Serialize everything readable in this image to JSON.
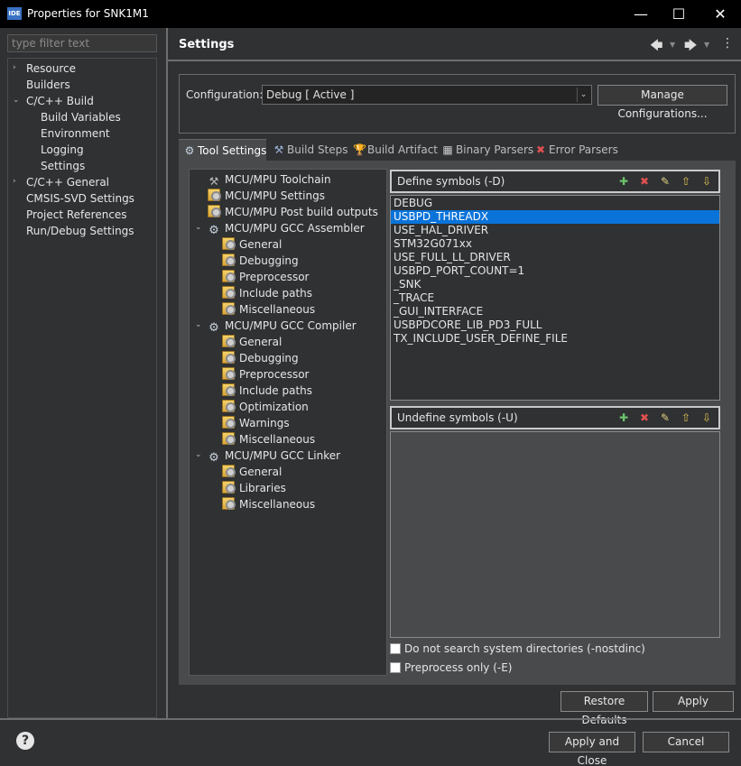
{
  "window": {
    "app_icon": "IDE",
    "title": "Properties for SNK1M1",
    "minimize": "—",
    "maximize": "☐",
    "close": "✕"
  },
  "filter": {
    "placeholder": "type filter text"
  },
  "nav": {
    "items": [
      {
        "label": "Resource",
        "expand": "›"
      },
      {
        "label": "Builders",
        "expand": ""
      },
      {
        "label": "C/C++ Build",
        "expand": "⌄"
      },
      {
        "label": "Build Variables",
        "expand": ""
      },
      {
        "label": "Environment",
        "expand": ""
      },
      {
        "label": "Logging",
        "expand": ""
      },
      {
        "label": "Settings",
        "expand": ""
      },
      {
        "label": "C/C++ General",
        "expand": "›"
      },
      {
        "label": "CMSIS-SVD Settings",
        "expand": ""
      },
      {
        "label": "Project References",
        "expand": ""
      },
      {
        "label": "Run/Debug Settings",
        "expand": ""
      }
    ]
  },
  "page": {
    "title": "Settings",
    "back_icon": "🡄",
    "forward_icon": "🡆",
    "menu_icon": "⋮"
  },
  "config": {
    "label": "Configuration:",
    "value": "Debug  [ Active ]",
    "manage_label": "Manage Configurations..."
  },
  "tabs": [
    {
      "label": "Tool Settings",
      "icon": "gear-icon",
      "active": true
    },
    {
      "label": "Build Steps",
      "icon": "hammer-icon",
      "active": false
    },
    {
      "label": "Build Artifact",
      "icon": "trophy-icon",
      "active": false
    },
    {
      "label": "Binary Parsers",
      "icon": "binary-icon",
      "active": false
    },
    {
      "label": "Error Parsers",
      "icon": "error-icon",
      "active": false
    }
  ],
  "tool_tree": [
    {
      "label": "MCU/MPU Toolchain",
      "icon": "toolchain-icon"
    },
    {
      "label": "MCU/MPU Settings",
      "icon": "folder-icon"
    },
    {
      "label": "MCU/MPU Post build outputs",
      "icon": "folder-icon"
    },
    {
      "label": "MCU/MPU GCC Assembler",
      "icon": "gear-icon",
      "expand": "⌄"
    },
    {
      "label": "General",
      "icon": "folder-icon"
    },
    {
      "label": "Debugging",
      "icon": "folder-icon"
    },
    {
      "label": "Preprocessor",
      "icon": "folder-icon"
    },
    {
      "label": "Include paths",
      "icon": "folder-icon"
    },
    {
      "label": "Miscellaneous",
      "icon": "folder-icon"
    },
    {
      "label": "MCU/MPU GCC Compiler",
      "icon": "gear-icon",
      "expand": "⌄"
    },
    {
      "label": "General",
      "icon": "folder-icon"
    },
    {
      "label": "Debugging",
      "icon": "folder-icon"
    },
    {
      "label": "Preprocessor",
      "icon": "folder-icon"
    },
    {
      "label": "Include paths",
      "icon": "folder-icon"
    },
    {
      "label": "Optimization",
      "icon": "folder-icon"
    },
    {
      "label": "Warnings",
      "icon": "folder-icon"
    },
    {
      "label": "Miscellaneous",
      "icon": "folder-icon"
    },
    {
      "label": "MCU/MPU GCC Linker",
      "icon": "gear-icon",
      "expand": "⌄"
    },
    {
      "label": "General",
      "icon": "folder-icon"
    },
    {
      "label": "Libraries",
      "icon": "folder-icon"
    },
    {
      "label": "Miscellaneous",
      "icon": "folder-icon"
    }
  ],
  "define": {
    "title": "Define symbols (-D)",
    "symbols": [
      "DEBUG",
      "USBPD_THREADX",
      "USE_HAL_DRIVER",
      "STM32G071xx",
      "USE_FULL_LL_DRIVER",
      "USBPD_PORT_COUNT=1",
      "_SNK",
      "_TRACE",
      "_GUI_INTERFACE",
      "USBPDCORE_LIB_PD3_FULL",
      "TX_INCLUDE_USER_DEFINE_FILE"
    ],
    "selected": "USBPD_THREADX"
  },
  "undefine": {
    "title": "Undefine symbols (-U)",
    "symbols": []
  },
  "symbol_tools": [
    "add-icon",
    "delete-icon",
    "edit-icon",
    "move-up-icon",
    "move-down-icon"
  ],
  "options": {
    "nostdinc_label": "Do not search system directories (-nostdinc)",
    "preprocess_label": "Preprocess only (-E)"
  },
  "buttons": {
    "restore": "Restore Defaults",
    "apply": "Apply",
    "apply_close": "Apply and Close",
    "cancel": "Cancel",
    "help": "?"
  }
}
